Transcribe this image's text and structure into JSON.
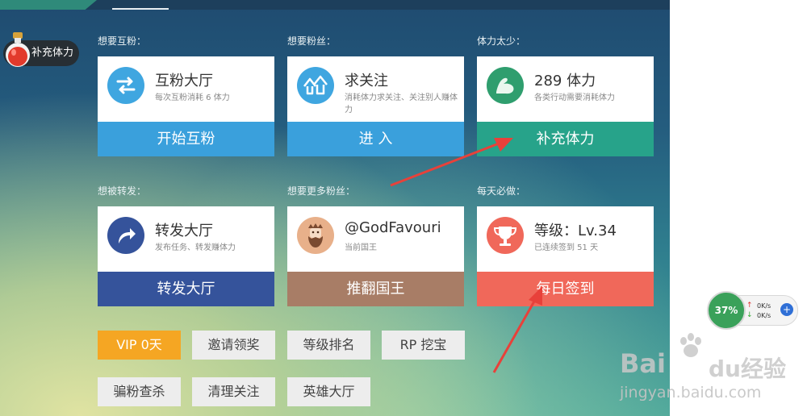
{
  "colors": {
    "blue_action": "#3aa0dc",
    "green_action": "#27a38a",
    "navy_action": "#35539b",
    "brown_action": "#a87d66",
    "coral_action": "#f0685a",
    "vip": "#f5a623",
    "arrow": "#e8413a"
  },
  "refill_pill": {
    "label": "补充体力",
    "icon": "potion-icon"
  },
  "cards": [
    {
      "section": "想要互粉：",
      "icon": "swap-arrows-icon",
      "title": "互粉大厅",
      "sub": "每次互粉消耗 6 体力",
      "action": "开始互粉"
    },
    {
      "section": "想要粉丝：",
      "icon": "up-arrows-icon",
      "title": "求关注",
      "sub": "消耗体力求关注、关注别人赚体力",
      "action": "进  入"
    },
    {
      "section": "体力太少：",
      "icon": "muscle-arm-icon",
      "title": "289 体力",
      "sub": "各类行动需要消耗体力",
      "action": "补充体力"
    },
    {
      "section": "想被转发：",
      "icon": "forward-arrow-icon",
      "title": "转发大厅",
      "sub": "发布任务、转发赚体力",
      "action": "转发大厅"
    },
    {
      "section": "想要更多粉丝：",
      "icon": "king-avatar-icon",
      "title": "@GodFavouri",
      "sub": "当前国王",
      "action": "推翻国王"
    },
    {
      "section": "每天必做：",
      "icon": "trophy-icon",
      "title": "等级：Lv.34",
      "sub": "已连续签到 51 天",
      "action": "每日签到"
    }
  ],
  "buttons": {
    "vip": "VIP 0天",
    "invite": "邀请领奖",
    "rank": "等级排名",
    "rp": "RP 挖宝",
    "check": "骗粉查杀",
    "clean": "清理关注",
    "hero": "英雄大厅"
  },
  "net_widget": {
    "percent": "37%",
    "upload": "0K/s",
    "download": "0K/s"
  },
  "watermark": {
    "logo": "Bai",
    "logo_suffix": "du",
    "cn": "经验",
    "url": "jingyan.baidu.com"
  }
}
